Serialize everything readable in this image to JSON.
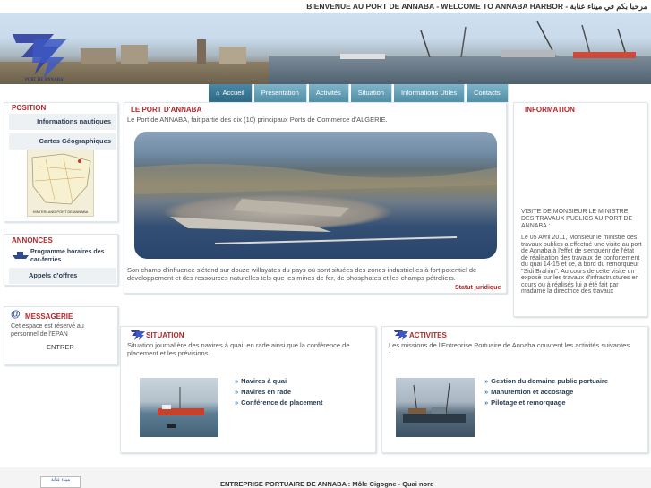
{
  "header": {
    "welcome": "BIENVENUE AU PORT DE ANNABA - WELCOME TO ANNABA HARBOR - مرحبا بكم في ميناء عنابة"
  },
  "logo": {
    "caption": "PORT DE ANNABA"
  },
  "nav": {
    "tabs": [
      {
        "label": "Accueil",
        "icon": "home-icon"
      },
      {
        "label": "Présentation"
      },
      {
        "label": "Activités"
      },
      {
        "label": "Situation"
      },
      {
        "label": "Informations Utiles"
      },
      {
        "label": "Contacts"
      }
    ]
  },
  "position": {
    "title": "POSITION",
    "items": [
      "Informations nautiques",
      "Cartes Géographiques"
    ],
    "map_caption": "HINTERLAND PORT DE ANNABA"
  },
  "annonces": {
    "title": "ANNONCES",
    "items": [
      "Programme horaires des car-ferries",
      "Appels d'offres"
    ]
  },
  "messagerie": {
    "title": "MESSAGERIE",
    "text": "Cet espace est réservé au personnel de l'EPAN",
    "enter": "ENTRER"
  },
  "leport": {
    "title": "LE PORT D'ANNABA",
    "intro": "Le Port de ANNABA, fait partie des dix (10) principaux Ports de Commerce d'ALGERIE.",
    "text": "Son champ d'influence s'étend sur douze willayates du pays où sont situées des zones industrielles à fort potentiel de développement et des ressources naturelles tels que les mines de fer, de phosphates et les champs pétroliers.",
    "link": "Statut juridique"
  },
  "information": {
    "title": "INFORMATION",
    "headline": "VISITE DE MONSIEUR LE MINISTRE DES TRAVAUX PUBLICS AU PORT DE ANNABA :",
    "body": "Le 05 Avril 2011, Monsieur le ministre des travaux publics a effectué une visite au port de Annaba à l'effet de s'enquérir de l'état de réalisation des travaux de confortement du quai 14-15 et ce, à bord du remorqueur \"Sidi Brahim\". Au cours de cette visite un exposé sur les travaux d'infrastructures en cours ou à réalisés lui a été fait par madame la directrice des travaux"
  },
  "situation": {
    "title": "SITUATION",
    "text": "Situation journalière des navires à quai, en rade ainsi que la conférence de placement et les prévisions...",
    "links": [
      "Navires à quai",
      "Navires en rade",
      "Conférence de placement"
    ]
  },
  "activites": {
    "title": "ACTIVITES",
    "text": "Les missions de l'Entreprise Portuaire de Annaba couvrent les activités suivantes :",
    "links": [
      "Gestion du domaine public portuaire",
      "Manutention et accostage",
      "Pilotage et remorquage"
    ]
  },
  "footer": {
    "text": "ENTREPRISE PORTUAIRE DE ANNABA : Môle Cigogne - Quai nord",
    "logo_text": "ميناء عنابة"
  },
  "colors": {
    "accent": "#b2282c",
    "tab": "#4f8ea7",
    "link": "#2c3e52"
  }
}
